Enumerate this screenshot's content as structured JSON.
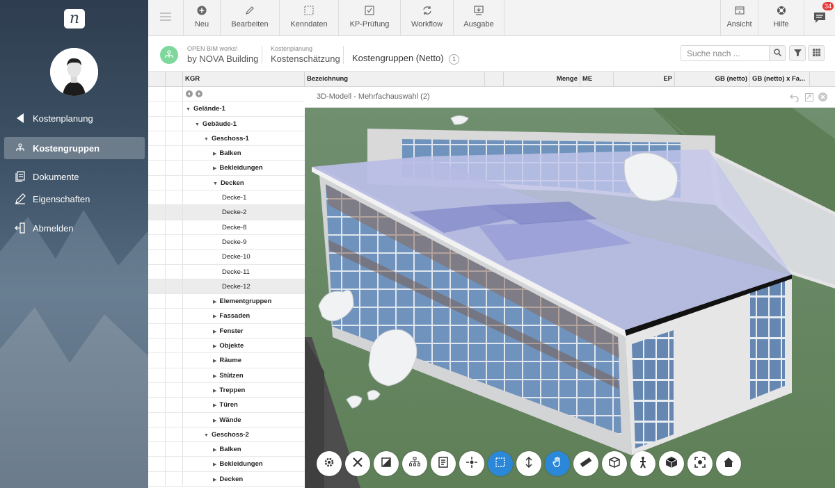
{
  "sidebar": {
    "logo_letter": "n",
    "items": [
      {
        "label": "Kostenplanung",
        "icon": "back-arrow-icon"
      },
      {
        "label": "Kostengruppen",
        "icon": "hierarchy-icon",
        "active": true
      },
      {
        "label": "Dokumente",
        "icon": "documents-icon"
      },
      {
        "label": "Eigenschaften",
        "icon": "pencil-icon"
      },
      {
        "label": "Abmelden",
        "icon": "logout-icon"
      }
    ]
  },
  "topbar": {
    "buttons": [
      {
        "label": "Neu",
        "icon": "plus-circle-icon"
      },
      {
        "label": "Bearbeiten",
        "icon": "pencil-icon"
      },
      {
        "label": "Kenndaten",
        "icon": "dashed-square-icon"
      },
      {
        "label": "KP-Prüfung",
        "icon": "checkbox-icon"
      },
      {
        "label": "Workflow",
        "icon": "sync-icon"
      },
      {
        "label": "Ausgabe",
        "icon": "download-icon"
      },
      {
        "label": "Ansicht",
        "icon": "window-icon"
      },
      {
        "label": "Hilfe",
        "icon": "lifebuoy-icon"
      }
    ],
    "messages_badge": "34"
  },
  "breadcrumb": {
    "project_small": "OPEN BIM works!",
    "project_big": "by NOVA Building",
    "section_small": "Kostenplanung",
    "section_big": "Kostenschätzung",
    "current": "Kostengruppen (Netto)",
    "count": "1"
  },
  "search": {
    "placeholder": "Suche nach ..."
  },
  "table": {
    "headers": {
      "kgr": "KGR",
      "bezeichnung": "Bezeichnung",
      "menge": "Menge",
      "me": "ME",
      "ep": "EP",
      "gb_netto": "GB (netto)",
      "gb_fa": "GB (netto) x Fa..."
    },
    "rows": [
      {
        "label": "Gelände-1",
        "level": 0,
        "bold": true,
        "toggle": "open"
      },
      {
        "label": "Gebäude-1",
        "level": 1,
        "bold": true,
        "toggle": "open"
      },
      {
        "label": "Geschoss-1",
        "level": 2,
        "bold": true,
        "toggle": "open"
      },
      {
        "label": "Balken",
        "level": 3,
        "bold": true,
        "toggle": "closed"
      },
      {
        "label": "Bekleidungen",
        "level": 3,
        "bold": true,
        "toggle": "closed"
      },
      {
        "label": "Decken",
        "level": 3,
        "bold": true,
        "toggle": "open"
      },
      {
        "label": "Decke-1",
        "level": 4,
        "bold": false,
        "toggle": ""
      },
      {
        "label": "Decke-2",
        "level": 4,
        "bold": false,
        "toggle": "",
        "selected": true
      },
      {
        "label": "Decke-8",
        "level": 4,
        "bold": false,
        "toggle": ""
      },
      {
        "label": "Decke-9",
        "level": 4,
        "bold": false,
        "toggle": ""
      },
      {
        "label": "Decke-10",
        "level": 4,
        "bold": false,
        "toggle": ""
      },
      {
        "label": "Decke-11",
        "level": 4,
        "bold": false,
        "toggle": ""
      },
      {
        "label": "Decke-12",
        "level": 4,
        "bold": false,
        "toggle": "",
        "selected": true
      },
      {
        "label": "Elementgruppen",
        "level": 3,
        "bold": true,
        "toggle": "closed"
      },
      {
        "label": "Fassaden",
        "level": 3,
        "bold": true,
        "toggle": "closed"
      },
      {
        "label": "Fenster",
        "level": 3,
        "bold": true,
        "toggle": "closed"
      },
      {
        "label": "Objekte",
        "level": 3,
        "bold": true,
        "toggle": "closed"
      },
      {
        "label": "Räume",
        "level": 3,
        "bold": true,
        "toggle": "closed"
      },
      {
        "label": "Stützen",
        "level": 3,
        "bold": true,
        "toggle": "closed"
      },
      {
        "label": "Treppen",
        "level": 3,
        "bold": true,
        "toggle": "closed"
      },
      {
        "label": "Türen",
        "level": 3,
        "bold": true,
        "toggle": "closed"
      },
      {
        "label": "Wände",
        "level": 3,
        "bold": true,
        "toggle": "closed"
      },
      {
        "label": "Geschoss-2",
        "level": 2,
        "bold": true,
        "toggle": "open"
      },
      {
        "label": "Balken",
        "level": 3,
        "bold": true,
        "toggle": "closed"
      },
      {
        "label": "Bekleidungen",
        "level": 3,
        "bold": true,
        "toggle": "closed"
      },
      {
        "label": "Decken",
        "level": 3,
        "bold": true,
        "toggle": "closed"
      }
    ]
  },
  "viewer": {
    "title": "3D-Modell - Mehrfachauswahl (2)",
    "tools": [
      "settings-icon",
      "tools-icon",
      "section-icon",
      "tree-icon",
      "properties-icon",
      "explode-icon",
      "selection-box-icon",
      "elevation-icon",
      "pan-icon",
      "measure-icon",
      "model-browser-icon",
      "walk-icon",
      "cube-icon",
      "fit-view-icon",
      "home-icon"
    ],
    "active_tools": [
      "selection-box-icon",
      "pan-icon"
    ]
  },
  "colors": {
    "accent": "#2b88d8",
    "sidebar_dark": "#2e3d4f",
    "bim_green": "#7ed89b",
    "badge_red": "#e53935"
  }
}
